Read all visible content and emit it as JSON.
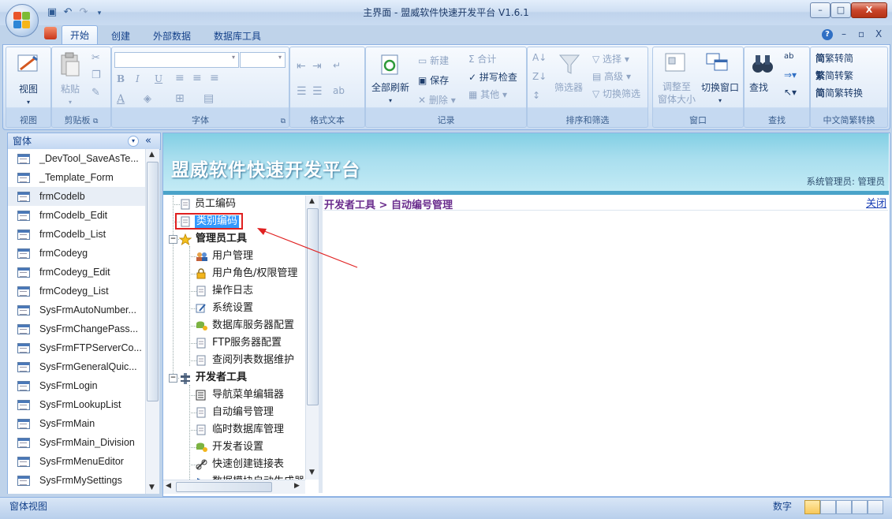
{
  "window": {
    "title": "主界面 - 盟威软件快速开发平台 V1.6.1",
    "controls": {
      "minimize": "–",
      "maximize": "□",
      "close": "X"
    }
  },
  "quick_access": {
    "icons": [
      "save-icon",
      "undo-icon",
      "redo-icon",
      "customize-icon"
    ]
  },
  "ribbon": {
    "tabs": [
      "开始",
      "创建",
      "外部数据",
      "数据库工具"
    ],
    "active_tab": "开始",
    "right_controls": {
      "help": "?",
      "minimize": "–",
      "restore": "▫",
      "close": "X"
    },
    "groups": {
      "view": {
        "caption": "视图",
        "button": "视图"
      },
      "clipboard": {
        "caption": "剪贴板",
        "paste": "粘贴",
        "launcher": "⧉"
      },
      "font": {
        "caption": "字体",
        "launcher": "⧉",
        "bold": "B",
        "italic": "I",
        "underline": "U",
        "font_color": "A"
      },
      "rich_text": {
        "caption": "格式文本"
      },
      "records": {
        "caption": "记录",
        "refresh_all": "全部刷新",
        "new": "新建",
        "save": "保存",
        "delete": "删除",
        "totals": "合计",
        "spelling": "拼写检查",
        "more": "其他"
      },
      "sort_filter": {
        "caption": "排序和筛选",
        "filter": "筛选器",
        "selection": "选择",
        "advanced": "高级",
        "toggle_filter": "切换筛选"
      },
      "window": {
        "caption": "窗口",
        "fit_window_line1": "调整至",
        "fit_window_line2": "窗体大小",
        "switch_windows": "切换窗口"
      },
      "find": {
        "caption": "查找",
        "find": "查找"
      },
      "chinese_conversion": {
        "caption": "中文简繁转换",
        "to_simplified": "繁转简",
        "to_traditional": "简转繁",
        "convert": "简繁转换"
      }
    }
  },
  "nav_pane": {
    "header": "窗体",
    "items": [
      "_DevTool_SaveAsTe...",
      "_Template_Form",
      "frmCodelb",
      "frmCodelb_Edit",
      "frmCodelb_List",
      "frmCodeyg",
      "frmCodeyg_Edit",
      "frmCodeyg_List",
      "SysFrmAutoNumber...",
      "SysFrmChangePass...",
      "SysFrmFTPServerCo...",
      "SysFrmGeneralQuic...",
      "SysFrmLogin",
      "SysFrmLookupList",
      "SysFrmMain",
      "SysFrmMain_Division",
      "SysFrmMenuEditor",
      "SysFrmMySettings"
    ],
    "selected_index": 2
  },
  "banner": {
    "title": "盟威软件快速开发平台",
    "user": "系统管理员: 管理员"
  },
  "tree": {
    "nodes": [
      {
        "label": "员工编码",
        "level": 1,
        "icon": "document-icon"
      },
      {
        "label": "类别编码",
        "level": 1,
        "icon": "document-icon",
        "selected": true
      },
      {
        "label": "管理员工具",
        "level": 0,
        "icon": "star-icon",
        "expanded": true,
        "bold": true
      },
      {
        "label": "用户管理",
        "level": 1,
        "icon": "users-icon"
      },
      {
        "label": "用户角色/权限管理",
        "level": 1,
        "icon": "lock-icon"
      },
      {
        "label": "操作日志",
        "level": 1,
        "icon": "document-icon"
      },
      {
        "label": "系统设置",
        "level": 1,
        "icon": "settings-pen-icon"
      },
      {
        "label": "数据库服务器配置",
        "level": 1,
        "icon": "database-icon"
      },
      {
        "label": "FTP服务器配置",
        "level": 1,
        "icon": "document-icon"
      },
      {
        "label": "查阅列表数据维护",
        "level": 1,
        "icon": "document-icon"
      },
      {
        "label": "开发者工具",
        "level": 0,
        "icon": "tools-icon",
        "expanded": true,
        "bold": true
      },
      {
        "label": "导航菜单编辑器",
        "level": 1,
        "icon": "list-icon"
      },
      {
        "label": "自动编号管理",
        "level": 1,
        "icon": "document-icon"
      },
      {
        "label": "临时数据库管理",
        "level": 1,
        "icon": "document-icon"
      },
      {
        "label": "开发者设置",
        "level": 1,
        "icon": "database-icon"
      },
      {
        "label": "快速创建链接表",
        "level": 1,
        "icon": "link-icon"
      },
      {
        "label": "数据模块自动生成器",
        "level": 1,
        "icon": "arrow-icon"
      }
    ]
  },
  "content": {
    "breadcrumb": "开发者工具 > 自动编号管理",
    "close_link": "关闭"
  },
  "status_bar": {
    "left": "窗体视图",
    "mode": "数字"
  },
  "colors": {
    "ribbon_blue": "#bfd3ea",
    "banner_cyan": "#a8deee",
    "highlight_red": "#e02020",
    "breadcrumb_purple": "#6a2d8d"
  }
}
